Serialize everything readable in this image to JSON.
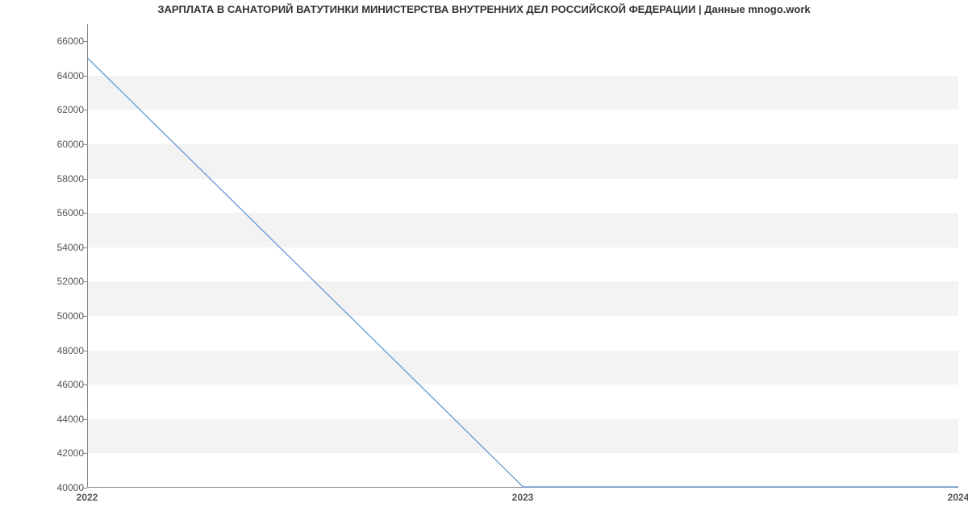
{
  "chart_data": {
    "type": "line",
    "title": "ЗАРПЛАТА В  САНАТОРИЙ ВАТУТИНКИ МИНИСТЕРСТВА ВНУТРЕННИХ ДЕЛ РОССИЙСКОЙ ФЕДЕРАЦИИ | Данные mnogo.work",
    "x": [
      2022,
      2023,
      2024
    ],
    "values": [
      65000,
      40000,
      40000
    ],
    "xlabel": "",
    "ylabel": "",
    "x_ticks": [
      2022,
      2023,
      2024
    ],
    "y_ticks": [
      40000,
      42000,
      44000,
      46000,
      48000,
      50000,
      52000,
      54000,
      56000,
      58000,
      60000,
      62000,
      64000,
      66000
    ],
    "xlim": [
      2022,
      2024
    ],
    "ylim": [
      40000,
      67000
    ],
    "line_color": "#6f9fd8"
  }
}
